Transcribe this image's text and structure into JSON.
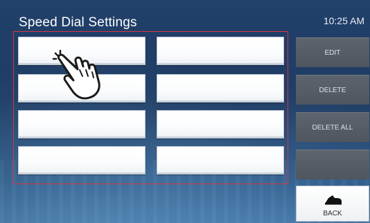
{
  "header": {
    "title": "Speed Dial Settings",
    "time": "10:25 AM"
  },
  "speed_dial": {
    "slots": [
      {
        "label": ""
      },
      {
        "label": ""
      },
      {
        "label": ""
      },
      {
        "label": ""
      },
      {
        "label": ""
      },
      {
        "label": ""
      },
      {
        "label": ""
      },
      {
        "label": ""
      }
    ],
    "highlight_color": "#d8353f"
  },
  "actions": {
    "edit_label": "EDIT",
    "delete_label": "DELETE",
    "delete_all_label": "DELETE ALL",
    "back_label": "BACK"
  },
  "icons": {
    "pointer": "hand-pointer-icon",
    "back": "back-arrow-icon"
  }
}
